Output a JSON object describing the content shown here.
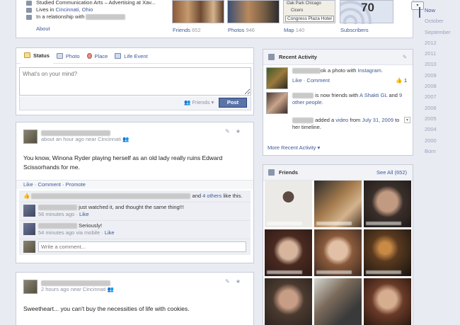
{
  "profile": {
    "bio": [
      {
        "prefix": "Studied Communication Arts – Advertising at Xav...",
        "link": ""
      },
      {
        "prefix": "Lives in ",
        "link": "Cincinnati, Ohio"
      },
      {
        "prefix": "In a relationship with ",
        "link": ""
      }
    ],
    "about_link": "About"
  },
  "thumbnails": [
    {
      "label": "Friends",
      "count": "652"
    },
    {
      "label": "Photos",
      "count": "946"
    },
    {
      "label": "Map",
      "count": "140"
    },
    {
      "label": "Subscribers",
      "count": ""
    }
  ],
  "map_labels": {
    "top": "Oak Park  Chicago",
    "mid": "Cicero",
    "place": "Congress Plaza Hotel"
  },
  "subscribers_count": "70",
  "timeline": [
    "Now",
    "October",
    "September",
    "2012",
    "2011",
    "2010",
    "2009",
    "2008",
    "2007",
    "2006",
    "2005",
    "2004",
    "2000",
    "Born"
  ],
  "composer": {
    "tabs": [
      "Status",
      "Photo",
      "Place",
      "Life Event"
    ],
    "placeholder": "What's on your mind?",
    "audience": "Friends",
    "post_button": "Post"
  },
  "story1": {
    "meta": "about an hour ago near Cincinnati",
    "text": "You know, Winona Ryder playing herself as an old lady really ruins Edward Scissorhands for me.",
    "actions": [
      "Like",
      "Comment",
      "Promote"
    ],
    "likes_suffix": "and",
    "likes_others": "4 others",
    "likes_tail": "like this.",
    "comments": [
      {
        "text": "just watched it, and thought the same thing!!!",
        "meta": "56 minutes ago",
        "like": "Like"
      },
      {
        "text": "Seriously!",
        "meta": "54 minutes ago via mobile",
        "like": "Like"
      }
    ],
    "write_placeholder": "Write a comment..."
  },
  "story2": {
    "meta": "2 hours ago near Cincinnati",
    "text": "Sweetheart... you can't buy the necessities of life with cookies."
  },
  "recent_activity": {
    "title": "Recent Activity",
    "items": [
      {
        "mid": "ok a photo with ",
        "link": "Instagram.",
        "actions": "Like · Comment",
        "like_count": "1"
      },
      {
        "mid": " is now friends with ",
        "link": "A Shakti GL",
        "tail": " and ",
        "link2": "9 other people."
      },
      {
        "mid": " added a ",
        "link": "video",
        "tail": " from ",
        "link2": "July 31, 2009",
        "tail2": " to her timeline."
      }
    ],
    "more": "More Recent Activity"
  },
  "friends_panel": {
    "title": "Friends",
    "see_all": "See All (652)",
    "cells": 9
  },
  "colors": {
    "brand": "#3b5998",
    "background": "#e9ebf3",
    "post_button": "#5b74a8"
  }
}
